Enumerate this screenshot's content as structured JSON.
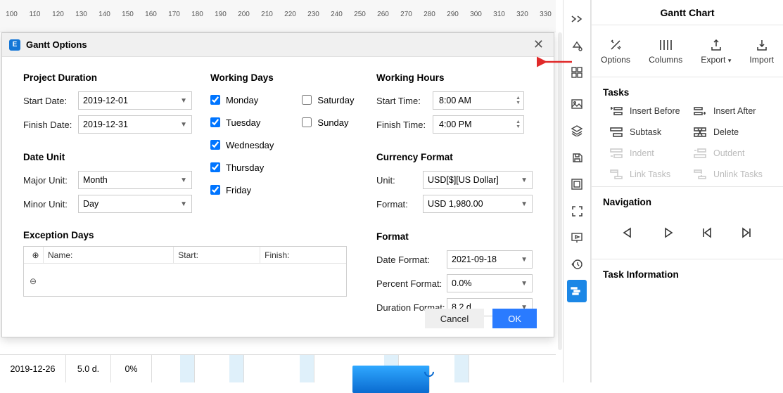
{
  "ruler_start": 100,
  "ruler_step": 10,
  "ruler_count": 72,
  "dialog": {
    "title": "Gantt Options",
    "ok": "OK",
    "cancel": "Cancel",
    "project_duration": {
      "title": "Project Duration",
      "start_label": "Start Date:",
      "start_value": "2019-12-01",
      "finish_label": "Finish Date:",
      "finish_value": "2019-12-31"
    },
    "date_unit": {
      "title": "Date Unit",
      "major_label": "Major Unit:",
      "major_value": "Month",
      "minor_label": "Minor Unit:",
      "minor_value": "Day"
    },
    "exception": {
      "title": "Exception Days",
      "col_name": "Name:",
      "col_start": "Start:",
      "col_finish": "Finish:"
    },
    "working_days": {
      "title": "Working Days",
      "days": [
        {
          "label": "Monday",
          "checked": true
        },
        {
          "label": "Tuesday",
          "checked": true
        },
        {
          "label": "Wednesday",
          "checked": true
        },
        {
          "label": "Thursday",
          "checked": true
        },
        {
          "label": "Friday",
          "checked": true
        },
        {
          "label": "Saturday",
          "checked": false
        },
        {
          "label": "Sunday",
          "checked": false
        }
      ]
    },
    "working_hours": {
      "title": "Working Hours",
      "start_label": "Start Time:",
      "start_value": "8:00 AM",
      "finish_label": "Finish Time:",
      "finish_value": "4:00 PM"
    },
    "currency": {
      "title": "Currency Format",
      "unit_label": "Unit:",
      "unit_value": "USD[$][US Dollar]",
      "format_label": "Format:",
      "format_value": "USD 1,980.00"
    },
    "format": {
      "title": "Format",
      "date_label": "Date Format:",
      "date_value": "2021-09-18",
      "percent_label": "Percent Format:",
      "percent_value": "0.0%",
      "duration_label": "Duration Format:",
      "duration_value": "8.2 d."
    }
  },
  "gantt_row": {
    "date": "2019-12-26",
    "duration": "5.0 d.",
    "percent": "0%"
  },
  "side": {
    "title": "Gantt Chart",
    "tabs": {
      "options": "Options",
      "columns": "Columns",
      "export": "Export",
      "import": "Import"
    },
    "tasks_title": "Tasks",
    "tasks": {
      "insert_before": "Insert Before",
      "insert_after": "Insert After",
      "subtask": "Subtask",
      "delete": "Delete",
      "indent": "Indent",
      "outdent": "Outdent",
      "link": "Link Tasks",
      "unlink": "Unlink Tasks"
    },
    "navigation_title": "Navigation",
    "info_title": "Task Information"
  }
}
